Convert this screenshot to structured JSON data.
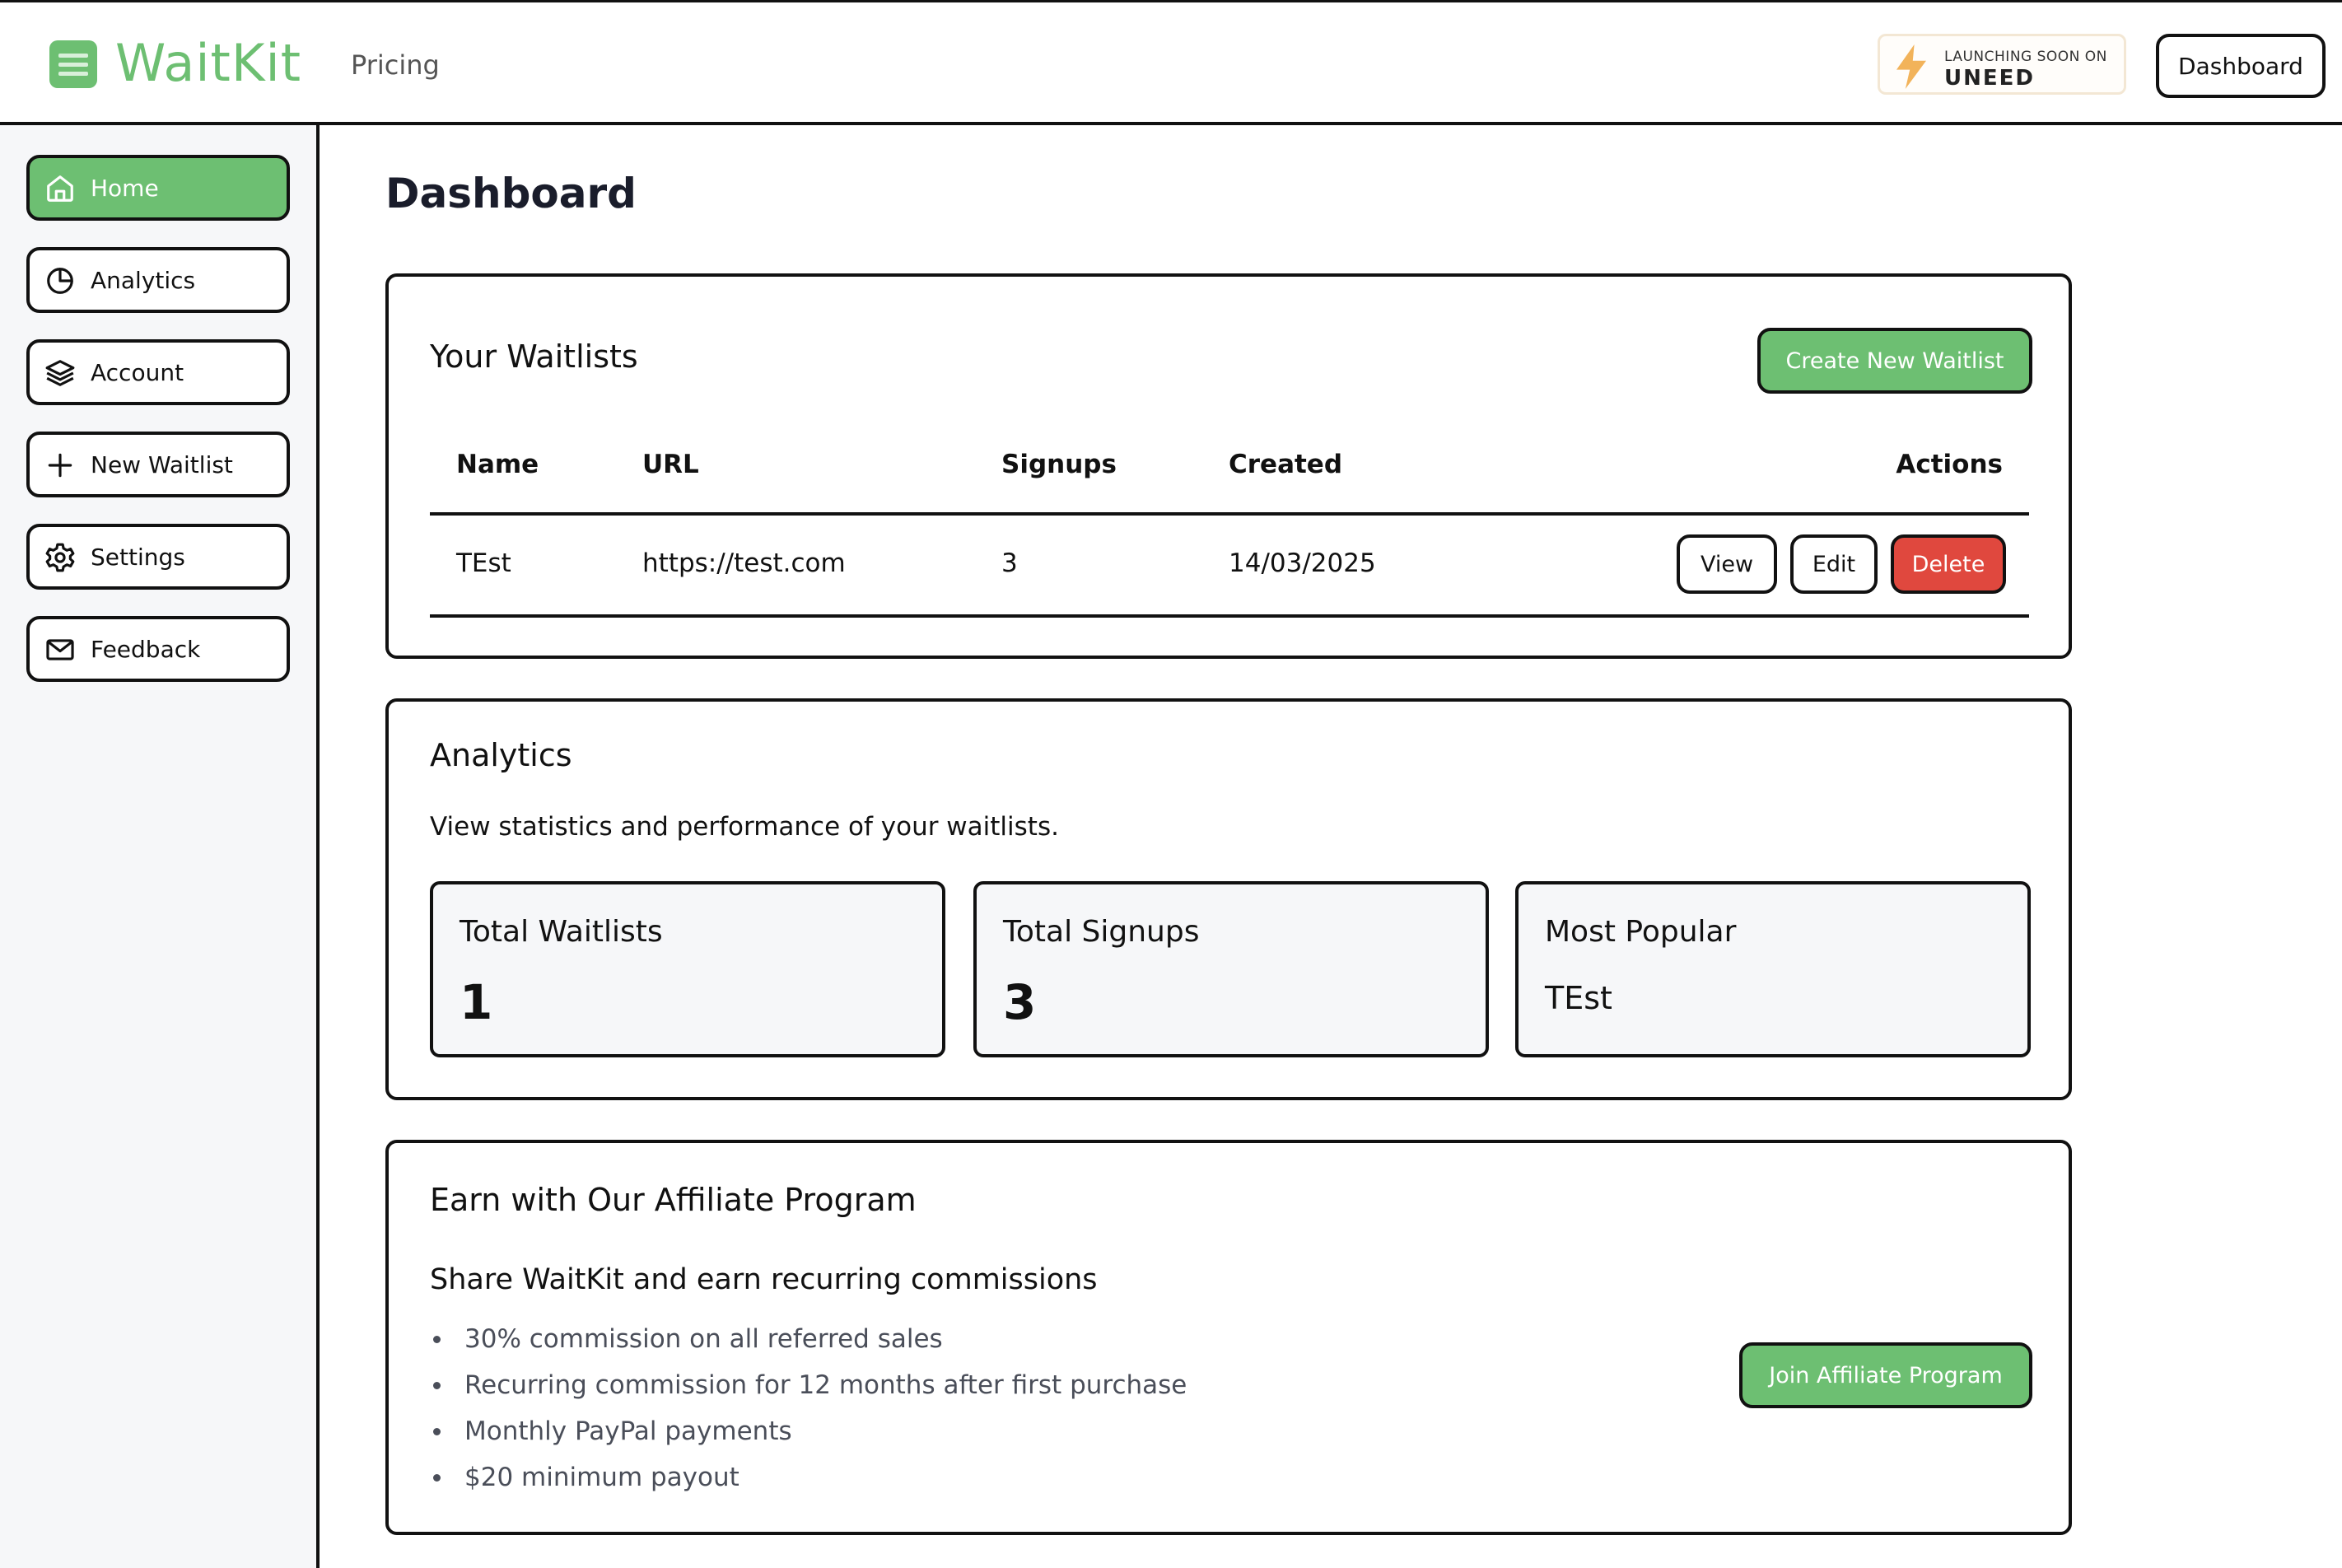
{
  "header": {
    "brand": "WaitKit",
    "nav_pricing": "Pricing",
    "badge_line1": "LAUNCHING SOON ON",
    "badge_line2": "UNEED",
    "dashboard_label": "Dashboard"
  },
  "sidebar": {
    "items": [
      {
        "label": "Home",
        "icon": "home-icon",
        "active": true
      },
      {
        "label": "Analytics",
        "icon": "pie-chart-icon",
        "active": false
      },
      {
        "label": "Account",
        "icon": "layers-icon",
        "active": false
      },
      {
        "label": "New Waitlist",
        "icon": "plus-icon",
        "active": false
      },
      {
        "label": "Settings",
        "icon": "gear-icon",
        "active": false
      },
      {
        "label": "Feedback",
        "icon": "mail-icon",
        "active": false
      }
    ]
  },
  "page": {
    "title": "Dashboard"
  },
  "waitlists": {
    "title": "Your Waitlists",
    "create_label": "Create New Waitlist",
    "columns": [
      "Name",
      "URL",
      "Signups",
      "Created",
      "Actions"
    ],
    "rows": [
      {
        "name": "TEst",
        "url": "https://test.com",
        "signups": "3",
        "created": "14/03/2025",
        "view": "View",
        "edit": "Edit",
        "delete": "Delete"
      }
    ]
  },
  "analytics": {
    "title": "Analytics",
    "description": "View statistics and performance of your waitlists.",
    "stats": [
      {
        "label": "Total Waitlists",
        "value": "1"
      },
      {
        "label": "Total Signups",
        "value": "3"
      },
      {
        "label": "Most Popular",
        "value": "TEst"
      }
    ]
  },
  "affiliate": {
    "title": "Earn with Our Affiliate Program",
    "subtitle": "Share WaitKit and earn recurring commissions",
    "bullets": [
      "30% commission on all referred sales",
      "Recurring commission for 12 months after first purchase",
      "Monthly PayPal payments",
      "$20 minimum payout"
    ],
    "join_label": "Join Affiliate Program"
  },
  "colors": {
    "brand_green": "#6dbf72",
    "danger_red": "#e0483e",
    "border": "#111111",
    "sidebar_bg": "#f6f7f9"
  }
}
